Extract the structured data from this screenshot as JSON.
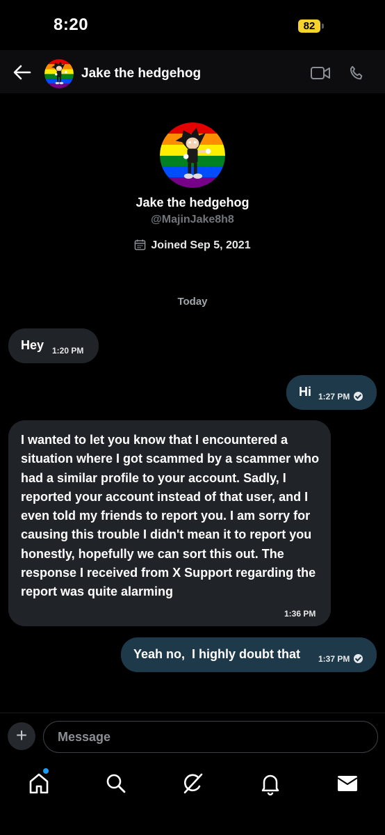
{
  "status_bar": {
    "time": "8:20",
    "battery": "82"
  },
  "header": {
    "name": "Jake the hedgehog"
  },
  "profile": {
    "name": "Jake the hedgehog",
    "handle": "@MajinJake8h8",
    "joined": "Joined Sep 5, 2021"
  },
  "conversation": {
    "date_label": "Today",
    "messages": [
      {
        "direction": "incoming",
        "text": "Hey",
        "time": "1:20 PM"
      },
      {
        "direction": "outgoing",
        "text": "Hi",
        "time": "1:27 PM",
        "status": "read"
      },
      {
        "direction": "incoming",
        "text": "I wanted to let you know that I encountered a situation where I got scammed by a scammer who had a similar profile to your account. Sadly, I reported your account instead of that user, and I even told my friends to report you. I am sorry for causing this trouble I didn't mean it to report you honestly, hopefully we can sort this out. The response I received from X Support regarding the report was quite alarming",
        "time": "1:36 PM"
      },
      {
        "direction": "outgoing",
        "text": "Yeah no,  I highly doubt that",
        "time": "1:37 PM",
        "status": "read"
      }
    ]
  },
  "composer": {
    "placeholder": "Message"
  },
  "tabs": [
    {
      "icon": "home-icon",
      "has_notification": true
    },
    {
      "icon": "search-icon"
    },
    {
      "icon": "grok-icon"
    },
    {
      "icon": "bell-icon"
    },
    {
      "icon": "mail-icon",
      "active": true
    }
  ],
  "colors": {
    "background": "#000000",
    "incoming_bubble": "#202327",
    "outgoing_bubble": "#1e3a4a",
    "notification_dot": "#1d9bf0",
    "battery": "#f6d22d"
  }
}
